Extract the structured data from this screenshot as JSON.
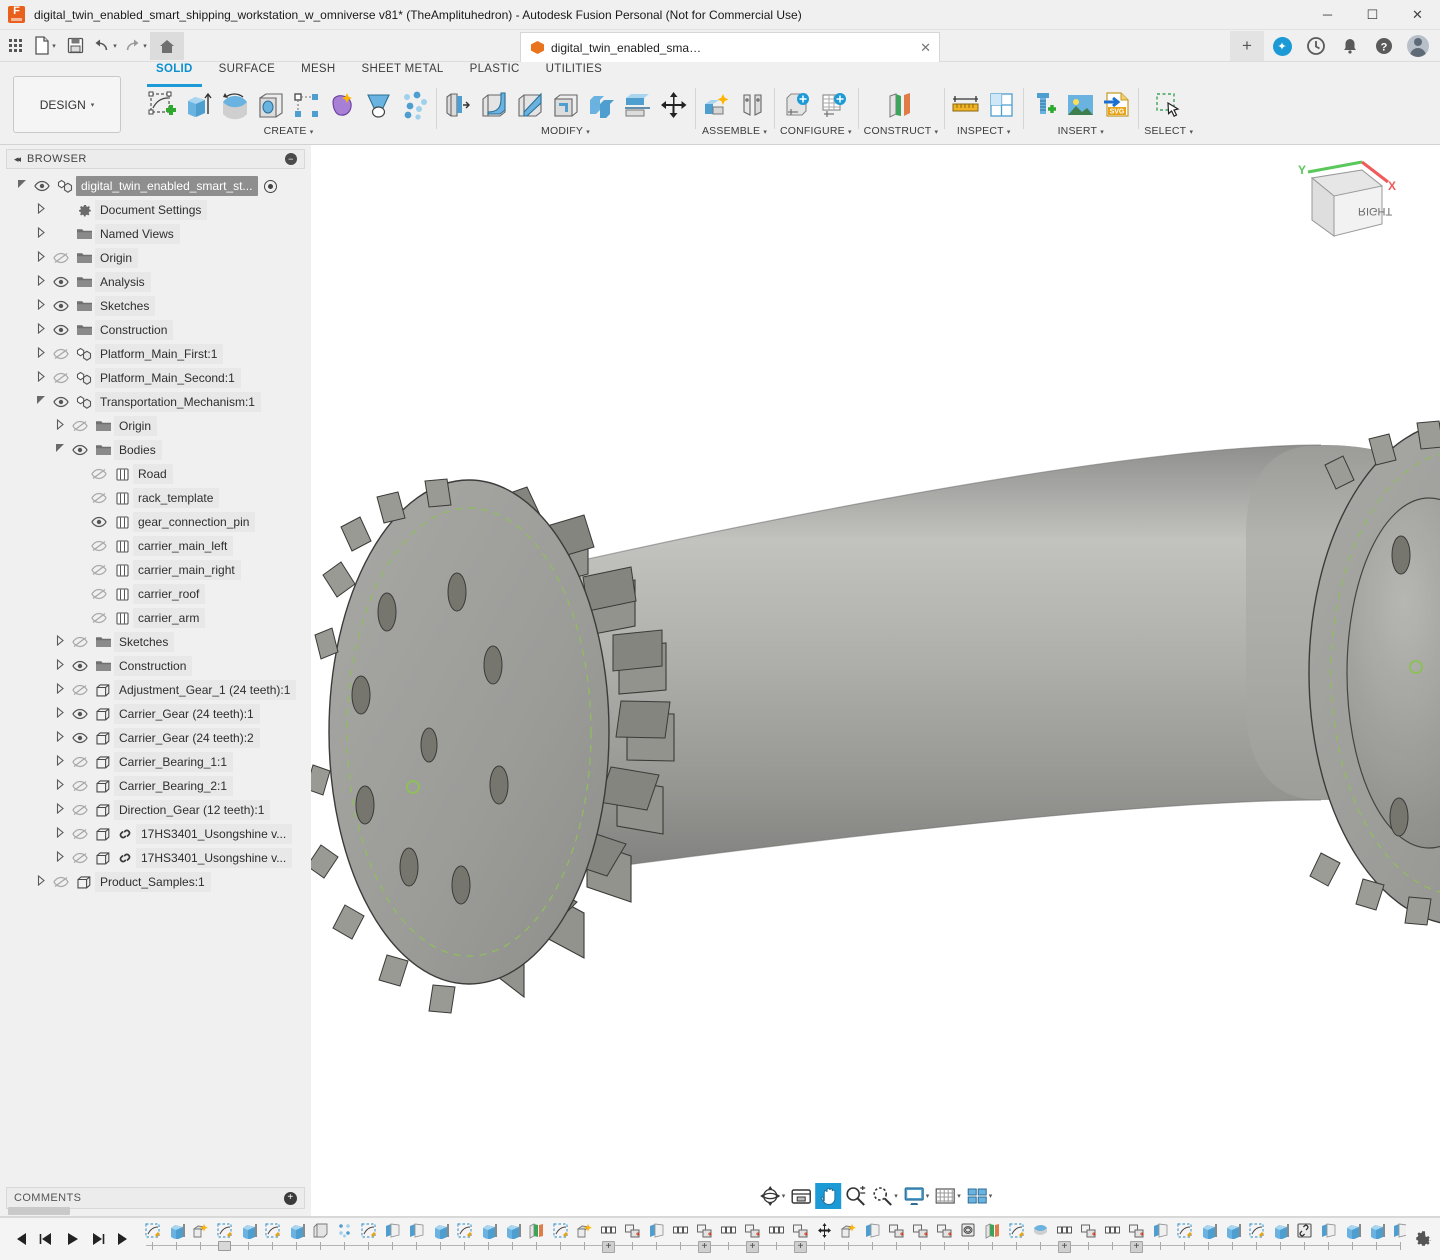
{
  "window": {
    "title": "digital_twin_enabled_smart_shipping_workstation_w_omniverse v81* (TheAmplituhedron) - Autodesk Fusion Personal (Not for Commercial Use)",
    "minimize": "─",
    "maximize": "☐",
    "close": "✕"
  },
  "quick_access": {
    "grid_label": "",
    "new_label": "",
    "save_label": "",
    "undo_label": "",
    "redo_label": "",
    "home_label": "",
    "document_tab": "digital_twin_enabled_smart_shipping_workstation_w_omniverse v81*",
    "tab_close": "✕",
    "new_tab": "+",
    "extension_glyph": "✦",
    "recent_glyph": "◴",
    "notification_glyph": "△",
    "help_glyph": "?"
  },
  "ribbon": {
    "workspace_label": "DESIGN",
    "workspace_caret": "▾",
    "tabs": [
      {
        "label": "SOLID",
        "active": true
      },
      {
        "label": "SURFACE",
        "active": false
      },
      {
        "label": "MESH",
        "active": false
      },
      {
        "label": "SHEET METAL",
        "active": false
      },
      {
        "label": "PLASTIC",
        "active": false
      },
      {
        "label": "UTILITIES",
        "active": false
      }
    ],
    "panels": [
      {
        "label": "CREATE",
        "caret": "▾",
        "icons": [
          "create-sketch-icon",
          "extrude-icon",
          "revolve-icon",
          "hole-icon",
          "rectangular-pattern-icon",
          "form-icon",
          "loft-icon",
          "pattern-icon"
        ]
      },
      {
        "label": "MODIFY",
        "caret": "▾",
        "icons": [
          "press-pull-icon",
          "fillet-icon",
          "chamfer-icon",
          "shell-icon",
          "combine-icon",
          "split-face-icon",
          "move-copy-icon"
        ]
      },
      {
        "label": "ASSEMBLE",
        "caret": "▾",
        "icons": [
          "new-component-icon",
          "joint-icon"
        ]
      },
      {
        "label": "CONFIGURE",
        "caret": "▾",
        "icons": [
          "configuration-icon",
          "configuration-table-icon"
        ]
      },
      {
        "label": "CONSTRUCT",
        "caret": "▾",
        "icons": [
          "offset-plane-icon"
        ]
      },
      {
        "label": "INSPECT",
        "caret": "▾",
        "icons": [
          "measure-icon",
          "section-analysis-icon"
        ]
      },
      {
        "label": "INSERT",
        "caret": "▾",
        "icons": [
          "insert-mcmaster-icon",
          "insert-image-icon",
          "insert-svg-icon"
        ]
      },
      {
        "label": "SELECT",
        "caret": "▾",
        "icons": [
          "select-window-icon"
        ]
      }
    ]
  },
  "browser": {
    "title": "BROWSER",
    "collapse_glyph": "◂◂",
    "minimize_glyph": "─",
    "tree": [
      {
        "label": "digital_twin_enabled_smart_st...",
        "indent": 0,
        "arrow": "open",
        "eye": "visible",
        "icon": "component-icon",
        "selected": true,
        "radio": true
      },
      {
        "label": "Document Settings",
        "indent": 1,
        "arrow": "closed",
        "eye": "none",
        "icon": "gear-icon"
      },
      {
        "label": "Named Views",
        "indent": 1,
        "arrow": "closed",
        "eye": "none",
        "icon": "folder-icon"
      },
      {
        "label": "Origin",
        "indent": 1,
        "arrow": "closed",
        "eye": "hidden",
        "icon": "folder-icon"
      },
      {
        "label": "Analysis",
        "indent": 1,
        "arrow": "closed",
        "eye": "visible",
        "icon": "folder-icon"
      },
      {
        "label": "Sketches",
        "indent": 1,
        "arrow": "closed",
        "eye": "visible",
        "icon": "folder-icon"
      },
      {
        "label": "Construction",
        "indent": 1,
        "arrow": "closed",
        "eye": "visible",
        "icon": "folder-icon"
      },
      {
        "label": "Platform_Main_First:1",
        "indent": 1,
        "arrow": "closed",
        "eye": "hidden",
        "icon": "component-icon"
      },
      {
        "label": "Platform_Main_Second:1",
        "indent": 1,
        "arrow": "closed",
        "eye": "hidden",
        "icon": "component-icon"
      },
      {
        "label": "Transportation_Mechanism:1",
        "indent": 1,
        "arrow": "open",
        "eye": "visible",
        "icon": "component-icon"
      },
      {
        "label": "Origin",
        "indent": 2,
        "arrow": "closed",
        "eye": "hidden",
        "icon": "folder-icon"
      },
      {
        "label": "Bodies",
        "indent": 2,
        "arrow": "open",
        "eye": "visible",
        "icon": "folder-icon"
      },
      {
        "label": "Road",
        "indent": 3,
        "arrow": "none",
        "eye": "hidden",
        "icon": "body-icon"
      },
      {
        "label": "rack_template",
        "indent": 3,
        "arrow": "none",
        "eye": "hidden",
        "icon": "body-icon"
      },
      {
        "label": "gear_connection_pin",
        "indent": 3,
        "arrow": "none",
        "eye": "visible",
        "icon": "body-icon"
      },
      {
        "label": "carrier_main_left",
        "indent": 3,
        "arrow": "none",
        "eye": "hidden",
        "icon": "body-icon"
      },
      {
        "label": "carrier_main_right",
        "indent": 3,
        "arrow": "none",
        "eye": "hidden",
        "icon": "body-icon"
      },
      {
        "label": "carrier_roof",
        "indent": 3,
        "arrow": "none",
        "eye": "hidden",
        "icon": "body-icon"
      },
      {
        "label": "carrier_arm",
        "indent": 3,
        "arrow": "none",
        "eye": "hidden",
        "icon": "body-icon"
      },
      {
        "label": "Sketches",
        "indent": 2,
        "arrow": "closed",
        "eye": "hidden",
        "icon": "folder-icon"
      },
      {
        "label": "Construction",
        "indent": 2,
        "arrow": "closed",
        "eye": "visible",
        "icon": "folder-icon"
      },
      {
        "label": "Adjustment_Gear_1 (24 teeth):1",
        "indent": 2,
        "arrow": "closed",
        "eye": "hidden",
        "icon": "solid-component-icon"
      },
      {
        "label": "Carrier_Gear (24 teeth):1",
        "indent": 2,
        "arrow": "closed",
        "eye": "visible",
        "icon": "solid-component-icon"
      },
      {
        "label": "Carrier_Gear (24 teeth):2",
        "indent": 2,
        "arrow": "closed",
        "eye": "visible",
        "icon": "solid-component-icon"
      },
      {
        "label": "Carrier_Bearing_1:1",
        "indent": 2,
        "arrow": "closed",
        "eye": "hidden",
        "icon": "solid-component-icon"
      },
      {
        "label": "Carrier_Bearing_2:1",
        "indent": 2,
        "arrow": "closed",
        "eye": "hidden",
        "icon": "solid-component-icon"
      },
      {
        "label": "Direction_Gear (12 teeth):1",
        "indent": 2,
        "arrow": "closed",
        "eye": "hidden",
        "icon": "solid-component-icon"
      },
      {
        "label": "17HS3401_Usongshine v...",
        "indent": 2,
        "arrow": "closed",
        "eye": "hidden",
        "icon": "linked-component-icon"
      },
      {
        "label": "17HS3401_Usongshine v...",
        "indent": 2,
        "arrow": "closed",
        "eye": "hidden",
        "icon": "linked-component-icon"
      },
      {
        "label": "Product_Samples:1",
        "indent": 1,
        "arrow": "closed",
        "eye": "hidden",
        "icon": "solid-component-icon"
      }
    ]
  },
  "comments": {
    "title": "COMMENTS",
    "add_glyph": "+"
  },
  "viewcube": {
    "face_label": "RIGHT",
    "axis_x": "X",
    "axis_y": "Y",
    "axis_x_color": "#f05a5a",
    "axis_y_color": "#5ac85a"
  },
  "navbar": {
    "items": [
      {
        "name": "orbit-icon",
        "active": false,
        "caret": true
      },
      {
        "name": "look-at-icon",
        "active": false,
        "caret": false
      },
      {
        "name": "pan-icon",
        "active": true,
        "caret": false
      },
      {
        "name": "zoom-icon",
        "active": false,
        "caret": false
      },
      {
        "name": "fit-icon",
        "active": false,
        "caret": true
      },
      {
        "name": "display-settings-icon",
        "active": false,
        "caret": true
      },
      {
        "name": "grid-snap-icon",
        "active": false,
        "caret": true
      },
      {
        "name": "viewports-icon",
        "active": false,
        "caret": true
      }
    ],
    "caret": "▾",
    "active_color": "#1c9ad6"
  },
  "timeline": {
    "controls": [
      {
        "name": "go-to-beginning-button",
        "glyph": "⏮"
      },
      {
        "name": "step-back-button",
        "glyph": "◀"
      },
      {
        "name": "play-button",
        "glyph": "▶"
      },
      {
        "name": "step-forward-button",
        "glyph": "▶▏"
      },
      {
        "name": "go-to-end-button",
        "glyph": "⏭"
      }
    ],
    "settings_glyph": "⚙",
    "features": [
      "sketch-icon",
      "extrude-icon",
      "new-component-icon",
      "sketch-icon",
      "extrude-icon",
      "sketch-icon",
      "extrude-icon",
      "fillet-icon",
      "pattern-icon",
      "sketch-icon",
      "plane-icon",
      "plane-icon",
      "extrude-icon",
      "sketch-icon",
      "extrude-icon",
      "extrude-icon",
      "construct-icon",
      "sketch-icon",
      "new-component-icon",
      "group-icon",
      "joint-icon",
      "plane-icon",
      "group-icon",
      "joint-icon",
      "group-icon",
      "joint-icon",
      "group-icon",
      "joint-icon",
      "move-icon",
      "new-component-icon",
      "plane-icon",
      "joint-icon",
      "joint-icon",
      "joint-icon",
      "thread-icon",
      "construct-icon",
      "sketch-icon",
      "revolve-icon",
      "group-icon",
      "joint-icon",
      "group-icon",
      "joint-icon",
      "plane-icon",
      "sketch-icon",
      "extrude-icon",
      "extrude-icon",
      "sketch-icon",
      "extrude-icon",
      "link-icon",
      "plane-icon",
      "extrude-icon",
      "extrude-icon",
      "plane-icon",
      "extrude-icon"
    ],
    "group_plus_after": [
      19,
      23,
      25,
      27,
      38,
      41
    ],
    "playhead_index": 3
  },
  "colors": {
    "accent": "#1c9ad6",
    "brand_orange": "#e8741e",
    "panel_bg": "#f0f0f0",
    "canvas_bg": "#ffffff",
    "model_gray": "#9e9e9c",
    "construction_green": "#8fbf5a"
  }
}
